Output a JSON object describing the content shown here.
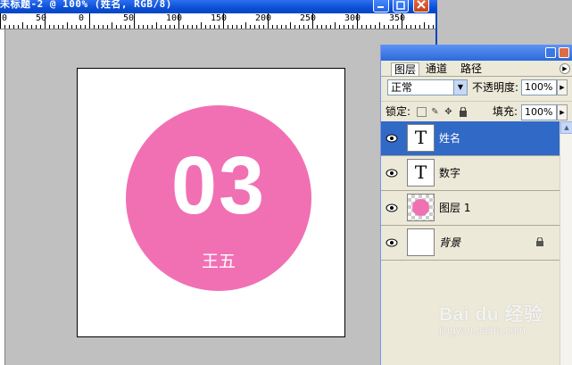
{
  "document_window": {
    "title": "未标题-2 @ 100% (姓名, RGB/8)",
    "ruler_ticks": [
      "0",
      "50",
      "0",
      "50",
      "100",
      "150",
      "200",
      "250",
      "300",
      "350"
    ]
  },
  "canvas": {
    "badge_number": "03",
    "badge_name": "王五",
    "badge_color": "#f170b4"
  },
  "layers_panel": {
    "tabs": [
      {
        "label": "图层",
        "active": true
      },
      {
        "label": "通道",
        "active": false
      },
      {
        "label": "路径",
        "active": false
      }
    ],
    "blend_mode": "正常",
    "opacity_label": "不透明度:",
    "opacity_value": "100%",
    "lock_label": "锁定:",
    "fill_label": "填充:",
    "fill_value": "100%",
    "layers": [
      {
        "name": "姓名",
        "thumb": "T",
        "selected": true
      },
      {
        "name": "数字",
        "thumb": "T",
        "selected": false
      },
      {
        "name": "图层 1",
        "thumb": "pink-circle",
        "selected": false
      },
      {
        "name": "背景",
        "thumb": "white",
        "selected": false,
        "locked": true
      }
    ],
    "selection_color": "#3169c6"
  },
  "watermark": {
    "logo": "Bai du 经验",
    "url": "jingyan.baidu.com"
  }
}
